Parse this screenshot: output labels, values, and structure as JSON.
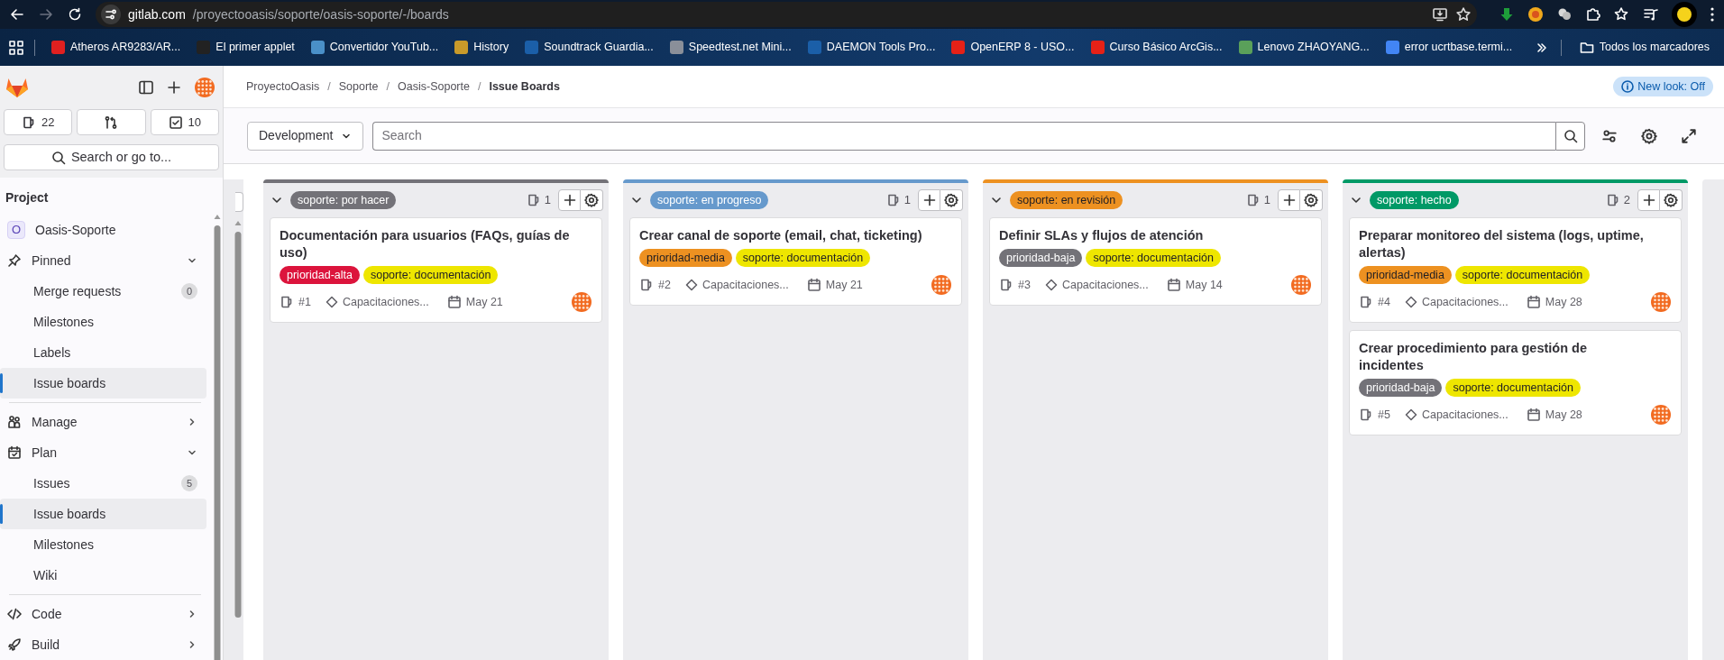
{
  "browser": {
    "forward": {
      "disabled": true
    },
    "address": {
      "host": "gitlab.com",
      "path": "/proyectooasis/soporte/oasis-soporte/-/boards"
    },
    "bookmarks": [
      {
        "label": "Atheros AR9283/AR...",
        "color": "#e02020"
      },
      {
        "label": "El primer applet",
        "color": "#222222"
      },
      {
        "label": "Convertidor YouTub...",
        "color": "#4a90c8"
      },
      {
        "label": "History",
        "color": "#c89a2a"
      },
      {
        "label": "Soundtrack Guardia...",
        "color": "#1b5fa8"
      },
      {
        "label": "Speedtest.net Mini...",
        "color": "#8a8f99"
      },
      {
        "label": "DAEMON Tools Pro...",
        "color": "#1b5fa8"
      },
      {
        "label": "OpenERP 8 - USO...",
        "color": "#e62117"
      },
      {
        "label": "Curso Básico ArcGis...",
        "color": "#e62117"
      },
      {
        "label": "Lenovo ZHAOYANG...",
        "color": "#5aa05a"
      },
      {
        "label": "error ucrtbase.termi...",
        "color": "#4285f4"
      }
    ],
    "all_bookmarks": "Todos los marcadores"
  },
  "sidebar": {
    "counts": [
      {
        "kind": "issues",
        "label": "22"
      },
      {
        "kind": "merge_requests"
      },
      {
        "kind": "todos",
        "label": "10"
      }
    ],
    "search": "Search or go to...",
    "section": "Project",
    "project": {
      "avatar": "O",
      "name": "Oasis-Soporte"
    },
    "groups": [
      {
        "kind": "pin",
        "label": "Pinned",
        "expanded": true,
        "children": [
          {
            "label": "Merge requests",
            "badge": "0",
            "selected": false
          },
          {
            "label": "Milestones",
            "selected": false
          },
          {
            "label": "Labels",
            "selected": false
          },
          {
            "label": "Issue boards",
            "selected": true
          }
        ]
      },
      {
        "kind": "manage",
        "label": "Manage",
        "expanded": false
      },
      {
        "kind": "plan",
        "label": "Plan",
        "expanded": true,
        "children": [
          {
            "label": "Issues",
            "badge": "5",
            "selected": false
          },
          {
            "label": "Issue boards",
            "selected": true
          },
          {
            "label": "Milestones",
            "selected": false
          },
          {
            "label": "Wiki",
            "selected": false
          }
        ]
      },
      {
        "kind": "code",
        "label": "Code",
        "expanded": false
      },
      {
        "kind": "build",
        "label": "Build",
        "expanded": false
      }
    ]
  },
  "breadcrumbs": [
    "ProyectoOasis",
    "Soporte",
    "Oasis-Soporte",
    "Issue Boards"
  ],
  "breadcrumb_separator": "/",
  "new_look": "New look: Off",
  "filter": {
    "board": "Development",
    "placeholder": "Search"
  },
  "lists": [
    {
      "label": "soporte: por hacer",
      "color": "#737278",
      "count": "1",
      "cards": [
        {
          "title": "Documentación para usuarios (FAQs, guías de uso)",
          "labels": [
            {
              "text": "prioridad-alta",
              "color": "#dc143c"
            },
            {
              "text": "soporte: documentación",
              "color": "#eee600"
            }
          ],
          "number": "#1",
          "milestone": "Capacitaciones...",
          "due": "May 21"
        }
      ]
    },
    {
      "label": "soporte: en progreso",
      "color": "#6699cc",
      "count": "1",
      "cards": [
        {
          "title": "Crear canal de soporte (email, chat, ticketing)",
          "labels": [
            {
              "text": "prioridad-media",
              "color": "#ed9121"
            },
            {
              "text": "soporte: documentación",
              "color": "#eee600"
            }
          ],
          "number": "#2",
          "milestone": "Capacitaciones...",
          "due": "May 21"
        }
      ]
    },
    {
      "label": "soporte: en revisión",
      "color": "#ed9121",
      "count": "1",
      "cards": [
        {
          "title": "Definir SLAs y flujos de atención",
          "labels": [
            {
              "text": "prioridad-baja",
              "color": "#737278"
            },
            {
              "text": "soporte: documentación",
              "color": "#eee600"
            }
          ],
          "number": "#3",
          "milestone": "Capacitaciones...",
          "due": "May 14"
        }
      ]
    },
    {
      "label": "soporte: hecho",
      "color": "#009966",
      "count": "2",
      "cards": [
        {
          "title": "Preparar monitoreo del sistema (logs, uptime, alertas)",
          "labels": [
            {
              "text": "prioridad-media",
              "color": "#ed9121"
            },
            {
              "text": "soporte: documentación",
              "color": "#eee600"
            }
          ],
          "number": "#4",
          "milestone": "Capacitaciones...",
          "due": "May 28"
        },
        {
          "title": "Crear procedimiento para gestión de incidentes",
          "labels": [
            {
              "text": "prioridad-baja",
              "color": "#737278"
            },
            {
              "text": "soporte: documentación",
              "color": "#eee600"
            }
          ],
          "number": "#5",
          "milestone": "Capacitaciones...",
          "due": "May 28"
        }
      ]
    }
  ]
}
